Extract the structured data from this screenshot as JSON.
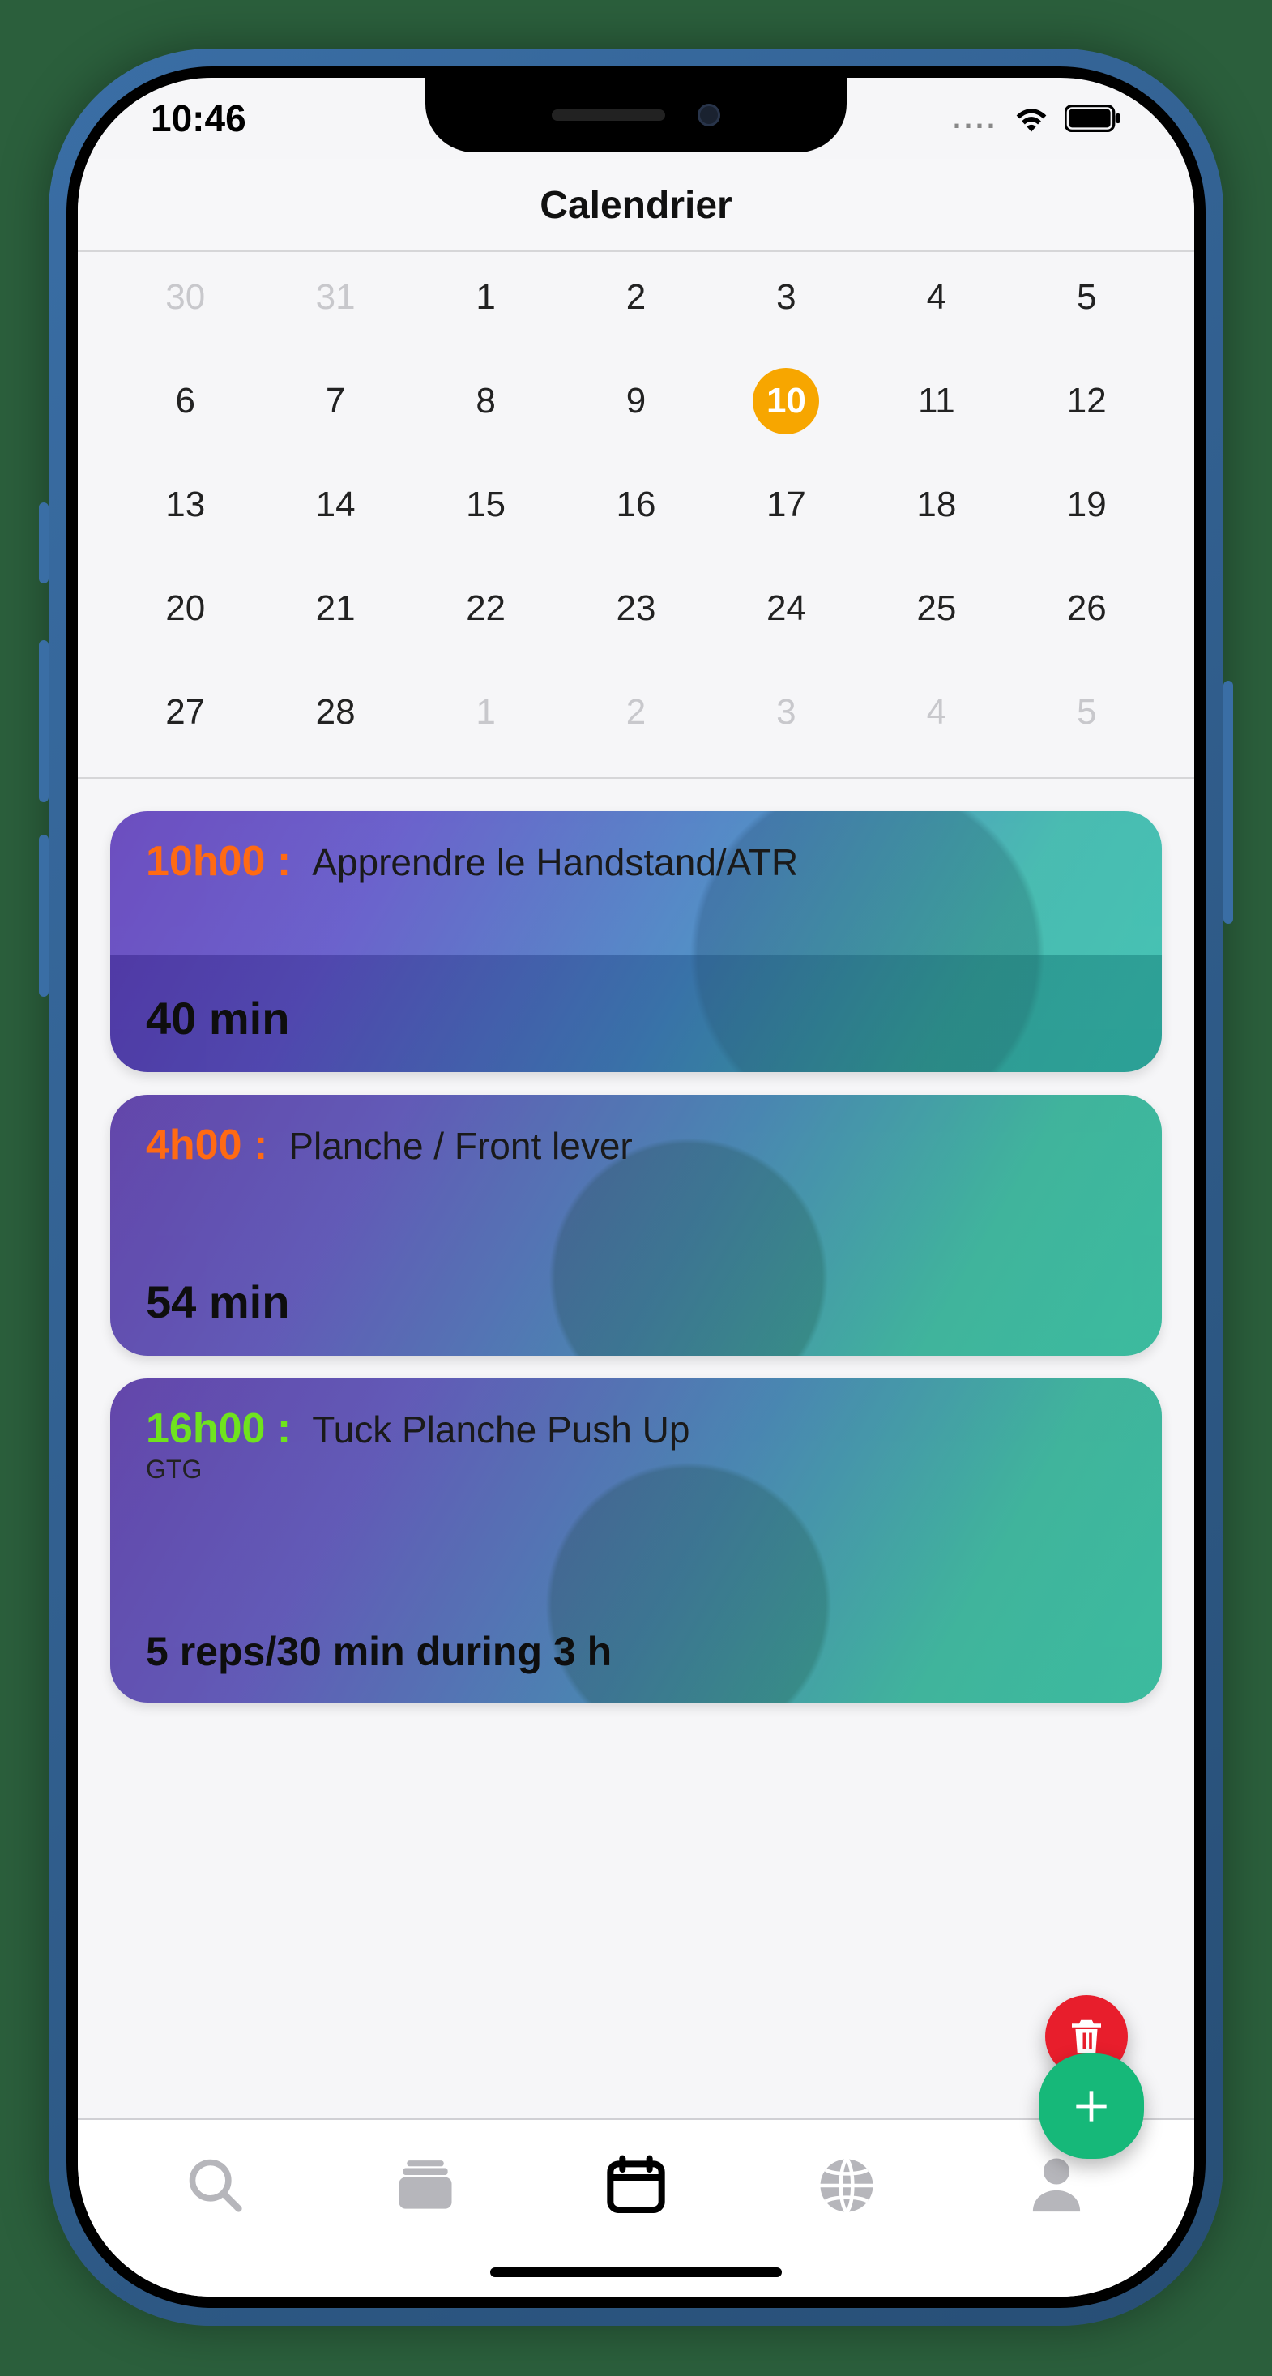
{
  "statusbar": {
    "time": "10:46"
  },
  "header": {
    "title": "Calendrier"
  },
  "calendar": {
    "selected_day": 10,
    "rows": [
      [
        {
          "n": "30",
          "faded": true
        },
        {
          "n": "31",
          "faded": true
        },
        {
          "n": "1"
        },
        {
          "n": "2"
        },
        {
          "n": "3"
        },
        {
          "n": "4"
        },
        {
          "n": "5"
        }
      ],
      [
        {
          "n": "6"
        },
        {
          "n": "7"
        },
        {
          "n": "8"
        },
        {
          "n": "9"
        },
        {
          "n": "10",
          "selected": true
        },
        {
          "n": "11"
        },
        {
          "n": "12"
        }
      ],
      [
        {
          "n": "13"
        },
        {
          "n": "14"
        },
        {
          "n": "15"
        },
        {
          "n": "16"
        },
        {
          "n": "17"
        },
        {
          "n": "18"
        },
        {
          "n": "19"
        }
      ],
      [
        {
          "n": "20"
        },
        {
          "n": "21"
        },
        {
          "n": "22"
        },
        {
          "n": "23"
        },
        {
          "n": "24"
        },
        {
          "n": "25"
        },
        {
          "n": "26"
        }
      ],
      [
        {
          "n": "27"
        },
        {
          "n": "28"
        },
        {
          "n": "1",
          "faded": true
        },
        {
          "n": "2",
          "faded": true
        },
        {
          "n": "3",
          "faded": true
        },
        {
          "n": "4",
          "faded": true
        },
        {
          "n": "5",
          "faded": true
        }
      ]
    ]
  },
  "agenda": {
    "cards": [
      {
        "time": "10h00 :",
        "time_color": "orange",
        "title": "Apprendre le Handstand/ATR",
        "subtitle": "",
        "bottom": "40 min"
      },
      {
        "time": "4h00 :",
        "time_color": "orange",
        "title": "Planche / Front lever",
        "subtitle": "",
        "bottom": "54 min"
      },
      {
        "time": "16h00 :",
        "time_color": "green",
        "title": "Tuck Planche Push Up",
        "subtitle": "GTG",
        "bottom": "5 reps/30 min during 3 h"
      }
    ]
  },
  "tabbar": {
    "active_index": 2,
    "items": [
      "search",
      "library",
      "calendar",
      "globe",
      "profile"
    ]
  },
  "colors": {
    "accent_orange": "#f7a600",
    "fab_green": "#16b879",
    "fab_red": "#e81e2c"
  }
}
